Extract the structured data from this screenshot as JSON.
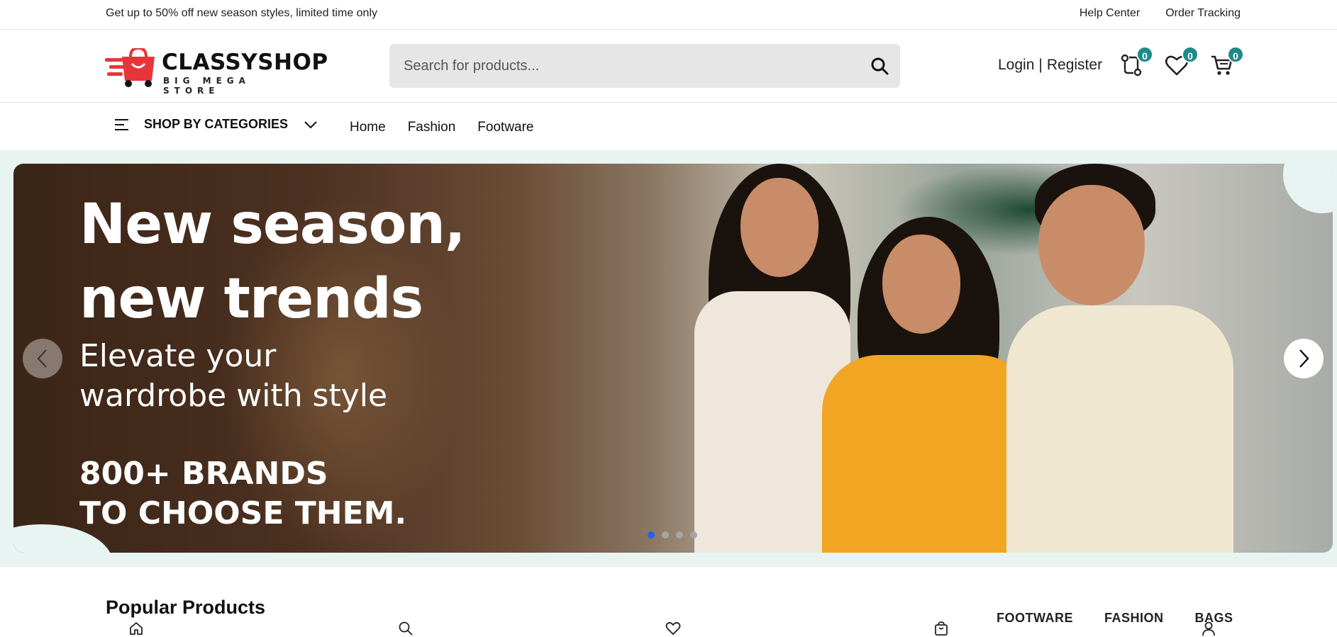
{
  "topbar": {
    "promo": "Get up to 50% off new season styles, limited time only",
    "help_center": "Help Center",
    "order_tracking": "Order Tracking"
  },
  "header": {
    "logo_name": "CLASSYSHOP",
    "logo_tagline": "BIG MEGA STORE",
    "search_placeholder": "Search for products...",
    "login": "Login",
    "separator": "|",
    "register": "Register",
    "compare_count": "0",
    "wishlist_count": "0",
    "cart_count": "0"
  },
  "nav": {
    "categories_label": "SHOP BY CATEGORIES",
    "links": [
      "Home",
      "Fashion",
      "Footware"
    ]
  },
  "hero": {
    "headline_line1": "New season,",
    "headline_line2": "new trends",
    "sub_line1": "Elevate your",
    "sub_line2": "wardrobe with style",
    "promo_line1": "800+ BRANDS",
    "promo_line2": "TO CHOOSE THEM.",
    "slide_count": 4,
    "active_slide": 1
  },
  "popular": {
    "title": "Popular Products",
    "tabs": [
      "FOOTWARE",
      "FASHION",
      "BAGS"
    ]
  },
  "colors": {
    "accent": "#1f8a8a",
    "hero_bg": "#e7f4f2",
    "logo_red": "#e8353b",
    "active_dot": "#1e63e6"
  },
  "icons": {
    "search": "search-icon",
    "compare": "compare-icon",
    "wishlist": "heart-icon",
    "cart": "cart-icon",
    "menu": "menu-icon",
    "chevron": "chevron-down-icon",
    "bottom_bar": [
      "home-icon",
      "search-icon",
      "heart-icon",
      "bag-icon",
      "user-icon"
    ]
  }
}
